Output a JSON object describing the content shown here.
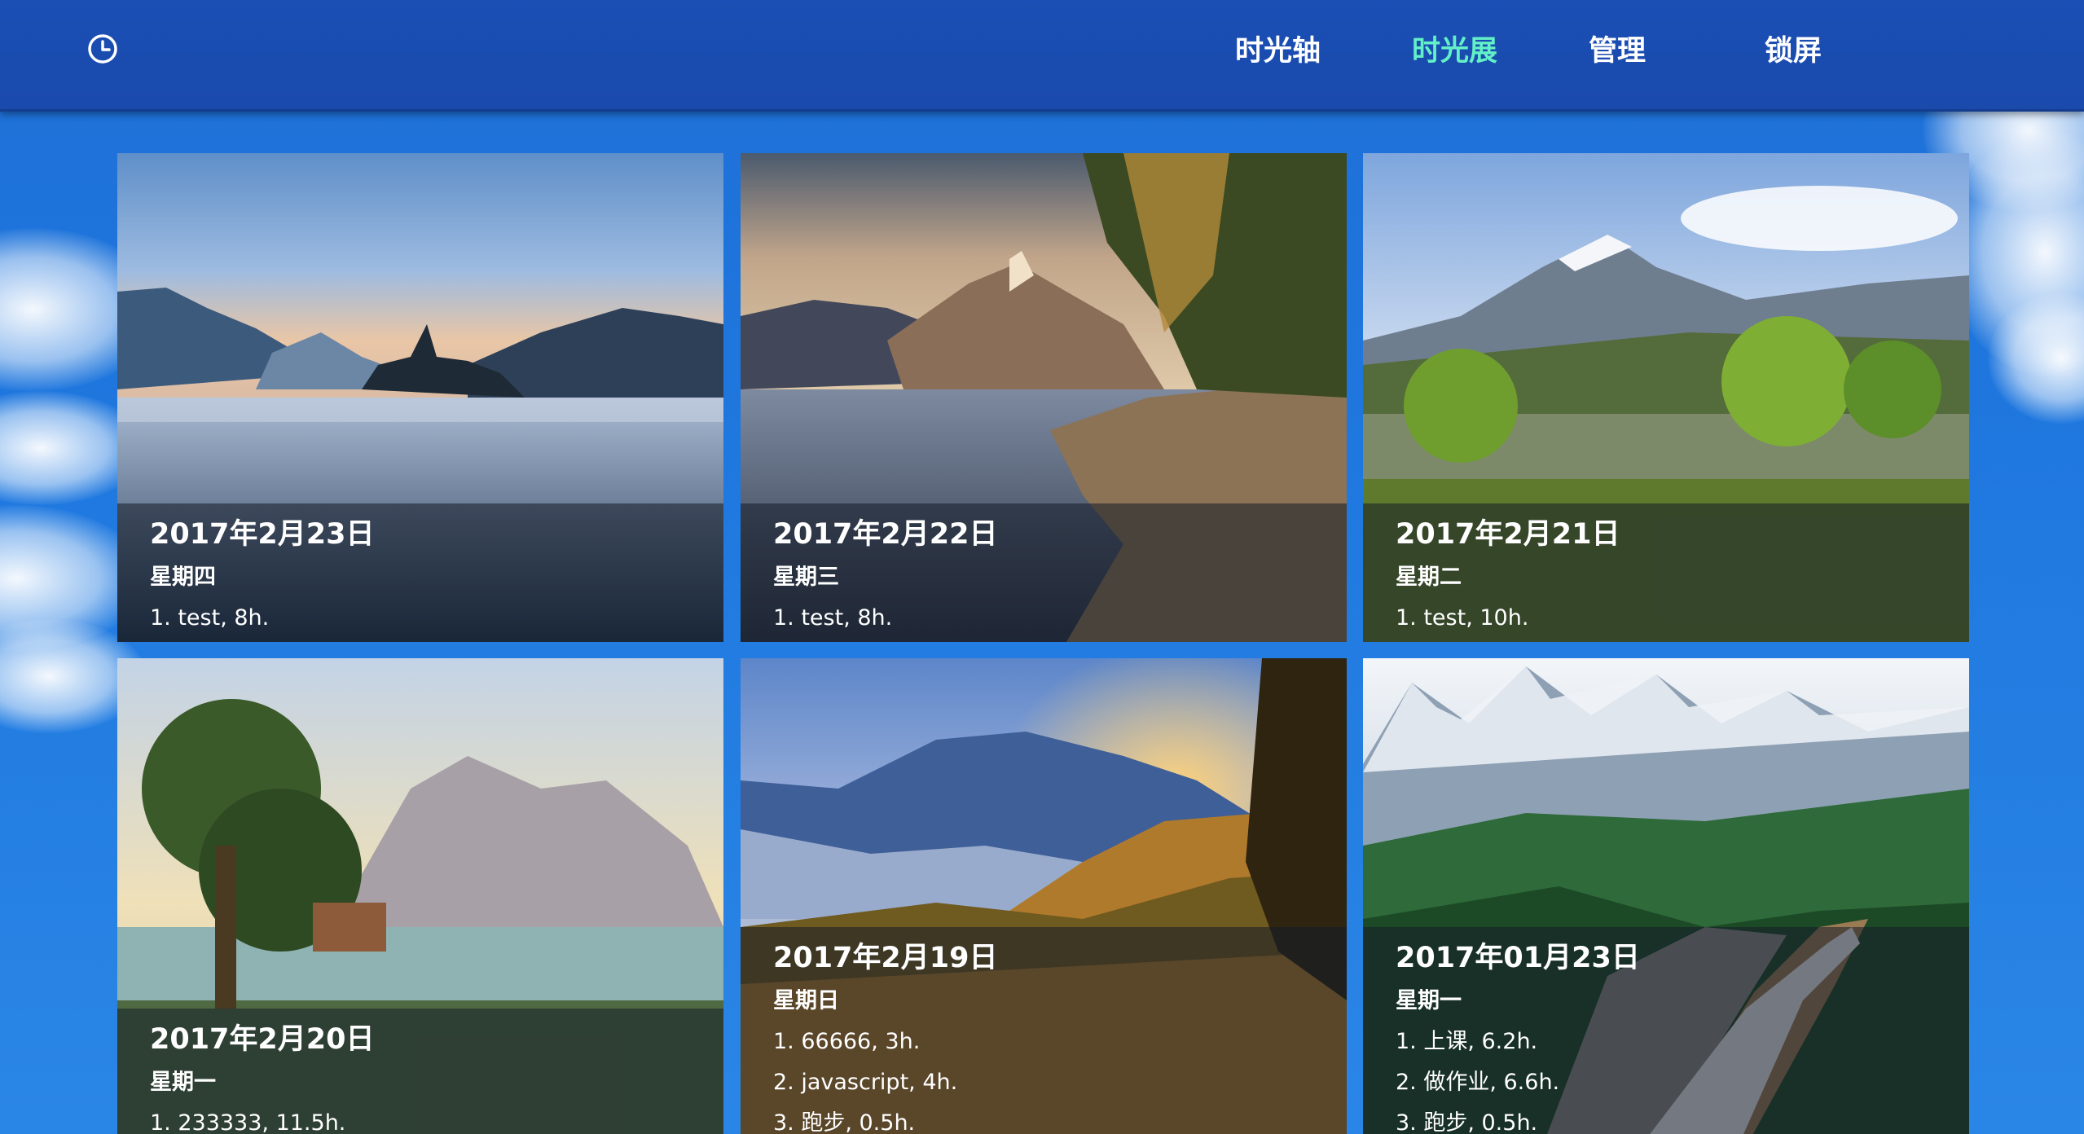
{
  "header": {
    "clock_icon": "clock-icon",
    "nav": [
      {
        "label": "时光轴",
        "active": false
      },
      {
        "label": "时光展",
        "active": true
      },
      {
        "label": "管理",
        "active": false
      },
      {
        "label": "锁屏",
        "active": false
      }
    ],
    "active_color": "#63f0c6"
  },
  "cards": [
    {
      "date": "2017年2月23日",
      "weekday": "星期四",
      "tasks": [
        "1. test, 8h."
      ],
      "scene": "alpine-lake-island-church"
    },
    {
      "date": "2017年2月22日",
      "weekday": "星期三",
      "tasks": [
        "1. test, 8h."
      ],
      "scene": "mountain-lake-autumn-shore"
    },
    {
      "date": "2017年2月21日",
      "weekday": "星期二",
      "tasks": [
        "1. test, 10h."
      ],
      "scene": "green-valley-lake"
    },
    {
      "date": "2017年2月20日",
      "weekday": "星期一",
      "tasks": [
        "1. 233333, 11.5h."
      ],
      "scene": "painted-lake-landscape"
    },
    {
      "date": "2017年2月19日",
      "weekday": "星期日",
      "tasks": [
        "1. 66666, 3h.",
        "2. javascript, 4h.",
        "3. 跑步, 0.5h."
      ],
      "scene": "sunrise-mountain-valley"
    },
    {
      "date": "2017年01月23日",
      "weekday": "星期一",
      "tasks": [
        "1. 上课, 6.2h.",
        "2. 做作业, 6.6h.",
        "3. 跑步, 0.5h."
      ],
      "scene": "mountain-train-forest"
    }
  ]
}
